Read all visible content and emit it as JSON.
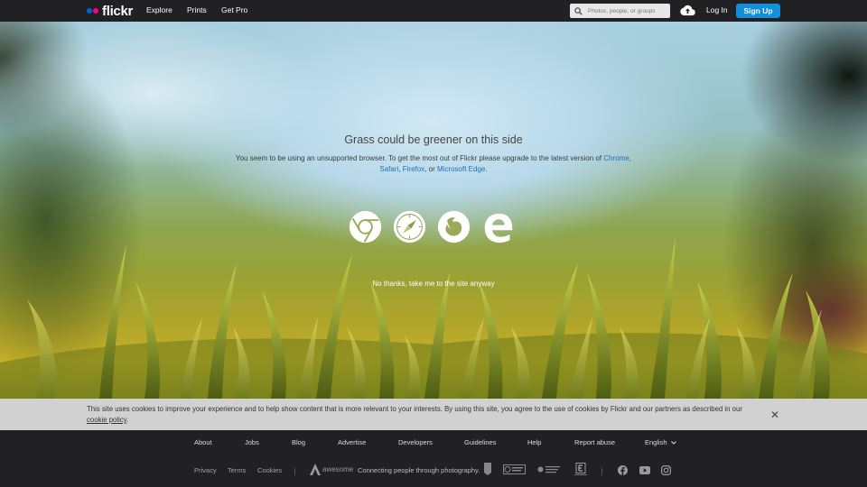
{
  "nav": {
    "logo": "flickr",
    "explore": "Explore",
    "prints": "Prints",
    "getpro": "Get Pro",
    "search_placeholder": "Photos, people, or groups",
    "login": "Log In",
    "signup": "Sign Up",
    "colors": {
      "blue_dot": "#0063dc",
      "pink_dot": "#ff0084",
      "signup_bg": "#128fdc"
    }
  },
  "hero": {
    "title": "Grass could be greener on this side",
    "msg_prefix": "You seem to be using an unsupported browser. To get the most out of Flickr please upgrade to the latest version of",
    "chrome": "Chrome",
    "safari": "Safari",
    "firefox": "Firefox",
    "edge": "Microsoft Edge",
    "msg_or": ", or",
    "browser_icons": [
      "chrome-icon",
      "safari-icon",
      "firefox-icon",
      "edge-icon"
    ],
    "no_thanks": "No thanks, take me to the site anyway"
  },
  "cookie": {
    "text": "This site uses cookies to improve your experience and to help show content that is more relevant to your interests. By using this site, you agree to the use of cookies by Flickr and our partners as described in our",
    "policy_link": "cookie policy",
    "close_glyph": "✕"
  },
  "footer": {
    "links": [
      "About",
      "Jobs",
      "Blog",
      "Advertise",
      "Developers",
      "Guidelines",
      "Help",
      "Report abuse"
    ],
    "language": "English",
    "legal": [
      "Privacy",
      "Terms",
      "Cookies"
    ],
    "brand": "awesome",
    "tagline": "Connecting people through photography.",
    "social_icons": [
      "facebook-icon",
      "youtube-icon",
      "instagram-icon"
    ]
  }
}
